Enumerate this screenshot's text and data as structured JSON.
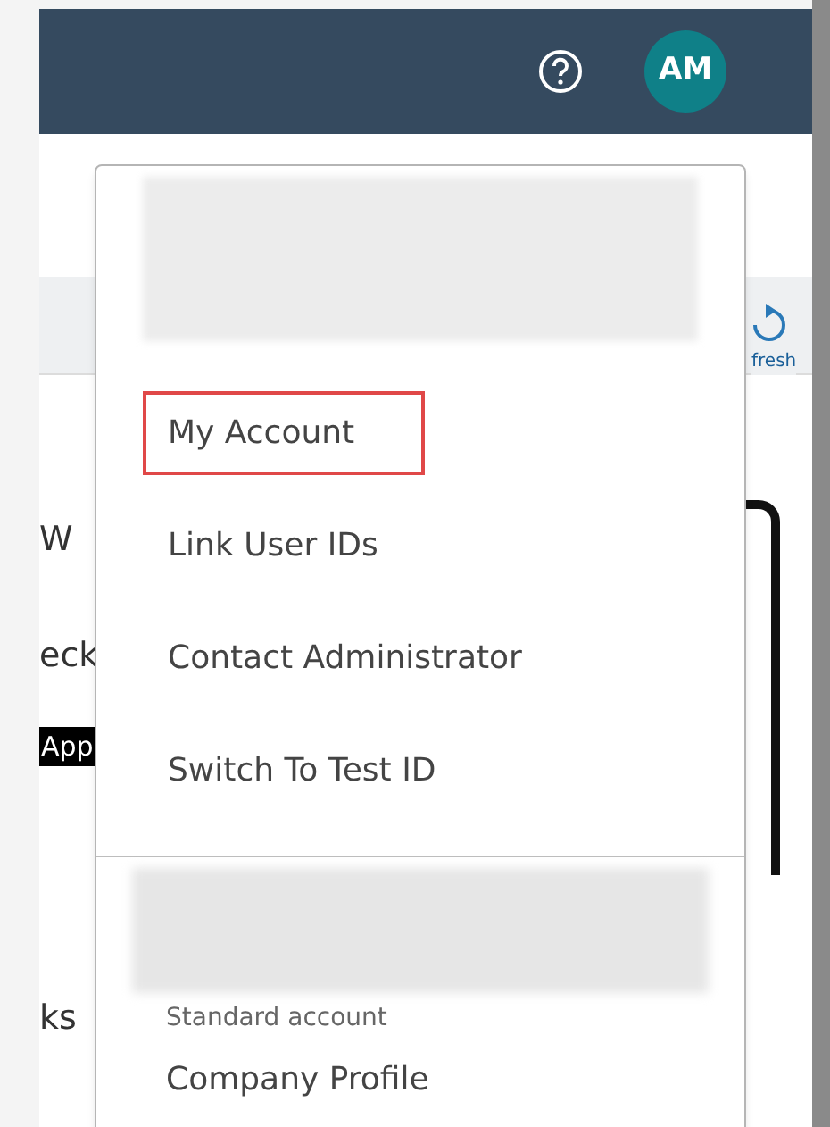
{
  "header": {
    "avatar_initials": "AM"
  },
  "background": {
    "refresh_label": "fresh",
    "texts": [
      "W",
      "eck",
      "ks"
    ],
    "app_badge": "App"
  },
  "menu": {
    "items": [
      {
        "label": "My Account",
        "highlighted": true
      },
      {
        "label": "Link User IDs",
        "highlighted": false
      },
      {
        "label": "Contact Administrator",
        "highlighted": false
      },
      {
        "label": "Switch To Test ID",
        "highlighted": false
      }
    ],
    "account_type": "Standard account",
    "company_item": "Company Profile"
  }
}
